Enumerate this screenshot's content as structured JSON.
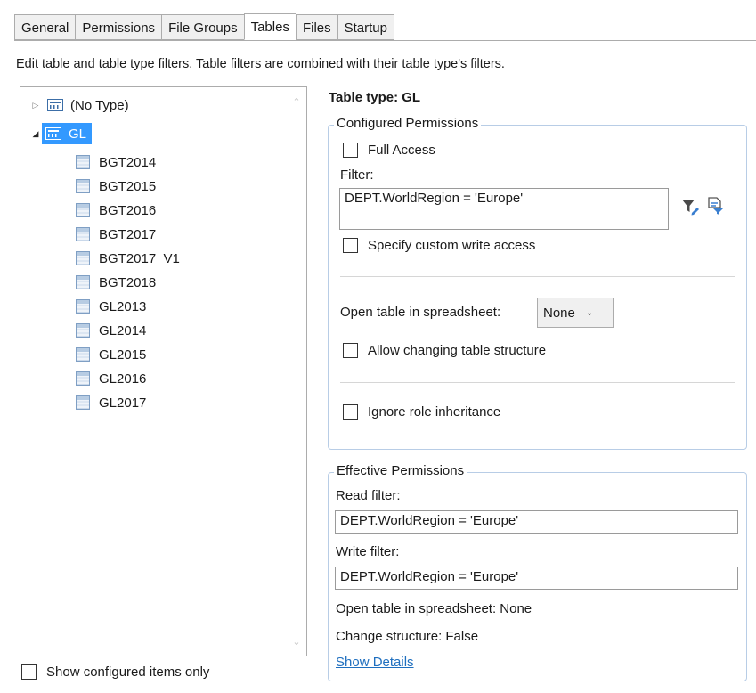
{
  "tabs": [
    "General",
    "Permissions",
    "File Groups",
    "Tables",
    "Files",
    "Startup"
  ],
  "active_tab": "Tables",
  "description": "Edit table and table type filters. Table filters are combined with their table type's filters.",
  "tree": {
    "types": [
      {
        "label": "(No Type)",
        "expanded": false
      },
      {
        "label": "GL",
        "expanded": true,
        "selected": true
      }
    ],
    "tables": [
      "BGT2014",
      "BGT2015",
      "BGT2016",
      "BGT2017",
      "BGT2017_V1",
      "BGT2018",
      "GL2013",
      "GL2014",
      "GL2015",
      "GL2016",
      "GL2017"
    ]
  },
  "show_configured_label": "Show configured items only",
  "table_type_title": "Table type: GL",
  "configured": {
    "legend": "Configured Permissions",
    "full_access_label": "Full Access",
    "filter_label": "Filter:",
    "filter_value": "DEPT.WorldRegion = 'Europe'",
    "custom_write_label": "Specify custom write access",
    "open_in_spreadsheet_label": "Open table in spreadsheet:",
    "open_in_spreadsheet_value": "None",
    "allow_changing_label": "Allow changing table structure",
    "ignore_inheritance_label": "Ignore role inheritance"
  },
  "effective": {
    "legend": "Effective Permissions",
    "read_filter_label": "Read filter:",
    "read_filter_value": "DEPT.WorldRegion = 'Europe'",
    "write_filter_label": "Write filter:",
    "write_filter_value": "DEPT.WorldRegion = 'Europe'",
    "open_in_spreadsheet_text": "Open table in spreadsheet: None",
    "change_structure_text": "Change structure: False",
    "show_details_label": "Show Details"
  },
  "icons": {
    "filter_edit": "filter-edit-icon",
    "filter_select": "filter-select-icon"
  }
}
